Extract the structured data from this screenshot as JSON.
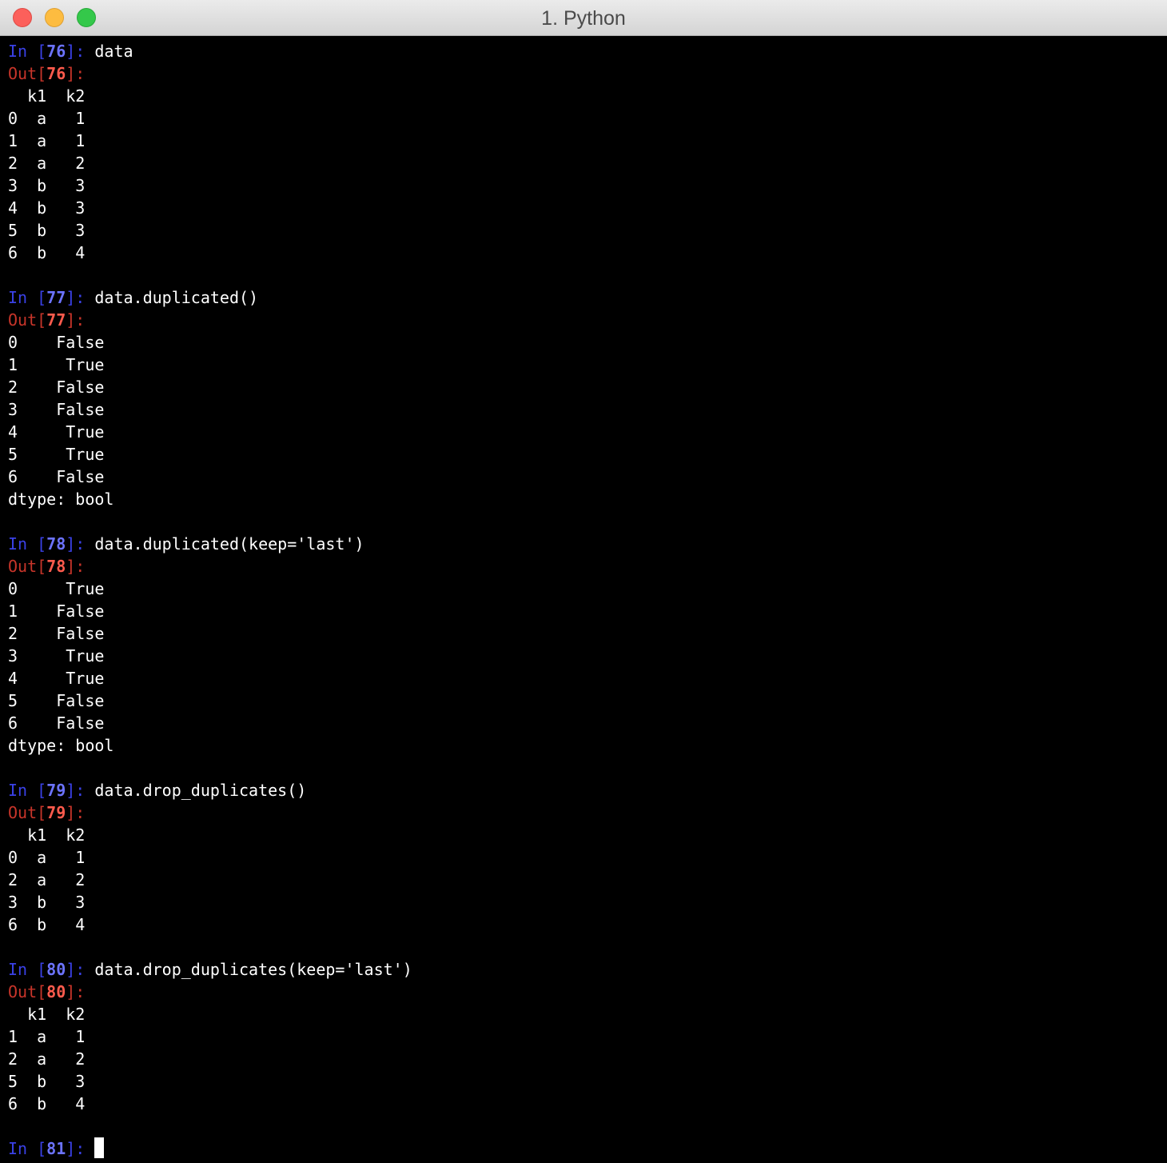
{
  "window": {
    "title": "1. Python",
    "colors": {
      "background": "#000000",
      "text": "#ffffff",
      "prompt_in": "#3a41e6",
      "prompt_out": "#c8352a"
    }
  },
  "cells": [
    {
      "in_label": "In [",
      "in_num": "76",
      "in_close": "]: ",
      "command": "data",
      "out_label": "Out[",
      "out_num": "76",
      "out_close": "]:",
      "output": [
        "  k1  k2",
        "0  a   1",
        "1  a   1",
        "2  a   2",
        "3  b   3",
        "4  b   3",
        "5  b   3",
        "6  b   4",
        ""
      ]
    },
    {
      "in_label": "In [",
      "in_num": "77",
      "in_close": "]: ",
      "command": "data.duplicated()",
      "out_label": "Out[",
      "out_num": "77",
      "out_close": "]:",
      "output": [
        "0    False",
        "1     True",
        "2    False",
        "3    False",
        "4     True",
        "5     True",
        "6    False",
        "dtype: bool",
        ""
      ]
    },
    {
      "in_label": "In [",
      "in_num": "78",
      "in_close": "]: ",
      "command": "data.duplicated(keep='last')",
      "out_label": "Out[",
      "out_num": "78",
      "out_close": "]:",
      "output": [
        "0     True",
        "1    False",
        "2    False",
        "3     True",
        "4     True",
        "5    False",
        "6    False",
        "dtype: bool",
        ""
      ]
    },
    {
      "in_label": "In [",
      "in_num": "79",
      "in_close": "]: ",
      "command": "data.drop_duplicates()",
      "out_label": "Out[",
      "out_num": "79",
      "out_close": "]:",
      "output": [
        "  k1  k2",
        "0  a   1",
        "2  a   2",
        "3  b   3",
        "6  b   4",
        ""
      ]
    },
    {
      "in_label": "In [",
      "in_num": "80",
      "in_close": "]: ",
      "command": "data.drop_duplicates(keep='last')",
      "out_label": "Out[",
      "out_num": "80",
      "out_close": "]:",
      "output": [
        "  k1  k2",
        "1  a   1",
        "2  a   2",
        "5  b   3",
        "6  b   4",
        ""
      ]
    }
  ],
  "prompt": {
    "in_label": "In [",
    "in_num": "81",
    "in_close": "]: "
  }
}
